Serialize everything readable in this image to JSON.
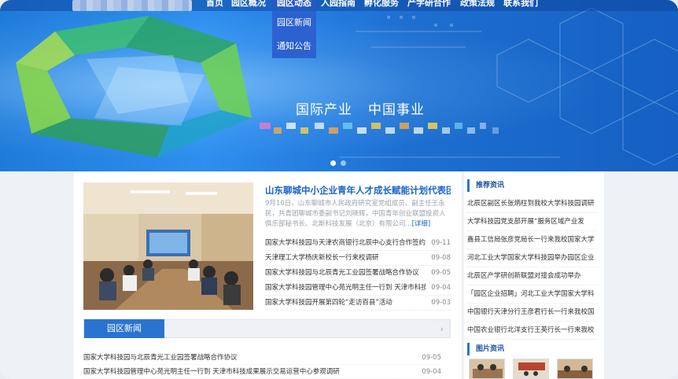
{
  "nav": {
    "items": [
      {
        "label": "首页",
        "active": false
      },
      {
        "label": "园区概况",
        "active": false
      },
      {
        "label": "园区动态",
        "active": true
      },
      {
        "label": "入园指南",
        "active": false
      },
      {
        "label": "孵化服务",
        "active": false
      },
      {
        "label": "产学研合作",
        "active": false
      },
      {
        "label": "政策法规",
        "active": false
      },
      {
        "label": "联系我们",
        "active": false
      }
    ],
    "dropdown": [
      "园区新闻",
      "通知公告"
    ]
  },
  "banner": {
    "slogan_1": "国际产业",
    "slogan_2": "中国事业",
    "slide_count": 2,
    "active_slide": 1
  },
  "featured": {
    "headline": "山东聊城中小企业青年人才成长赋能计划代表团到...",
    "summary": "9月10日，山东聊城市人民政府研究室党组成员、副主任王永民，共青团聊城市委副书记刘晓辉，中国青年创业联盟投资人俱乐部秘书长、北斯科技发展（北京）有限公司...",
    "more_label": "[详细]"
  },
  "news": [
    {
      "title": "国家大学科技园与天津农商银行北辰中心支行合作签约",
      "date": "09-11"
    },
    {
      "title": "天津理工大学杨庆新校长一行来校调研",
      "date": "09-08"
    },
    {
      "title": "国家大学科技园与北辰青光工业园签署战略合作协议",
      "date": "09-05"
    },
    {
      "title": "国家大学科技园管理中心苑光明主任一行到 天津市科技成...",
      "date": "09-04"
    },
    {
      "title": "国家大学科技园开展第四轮“走访百县”活动",
      "date": "09-03"
    }
  ],
  "tab": {
    "label": "园区新闻",
    "arrow": "›"
  },
  "news2": [
    {
      "title": "国家大学科技园与北辰青光工业园签署战略合作协议",
      "date": "09-05"
    },
    {
      "title": "国家大学科技园管理中心苑光明主任一行到 天津市科技成果展示交易运营中心参观调研",
      "date": "09-04"
    }
  ],
  "sidebar": {
    "recommend_title": "推荐资讯",
    "items": [
      "北辰区副区长张炳柱到我校大学科技园调研",
      "大学科技园党支部开展“服务区域产业发",
      "鑫县工信局张彦党局长一行来我校国家大学",
      "河北工业大学国家大学科技园举办园区企业",
      "北辰区产学研创新联盟对接会成功举办",
      "「园区企业招聘」河北工业大学国家大学科",
      "中国银行天津分行王彦君行长一行来我校国",
      "中国农业银行北洋支行王英行长一行来我校"
    ],
    "pictures_title": "图片资讯"
  },
  "colors": {
    "primary": "#2a74d1",
    "headline": "#1a63c8",
    "banner": "#1f7bd8"
  }
}
